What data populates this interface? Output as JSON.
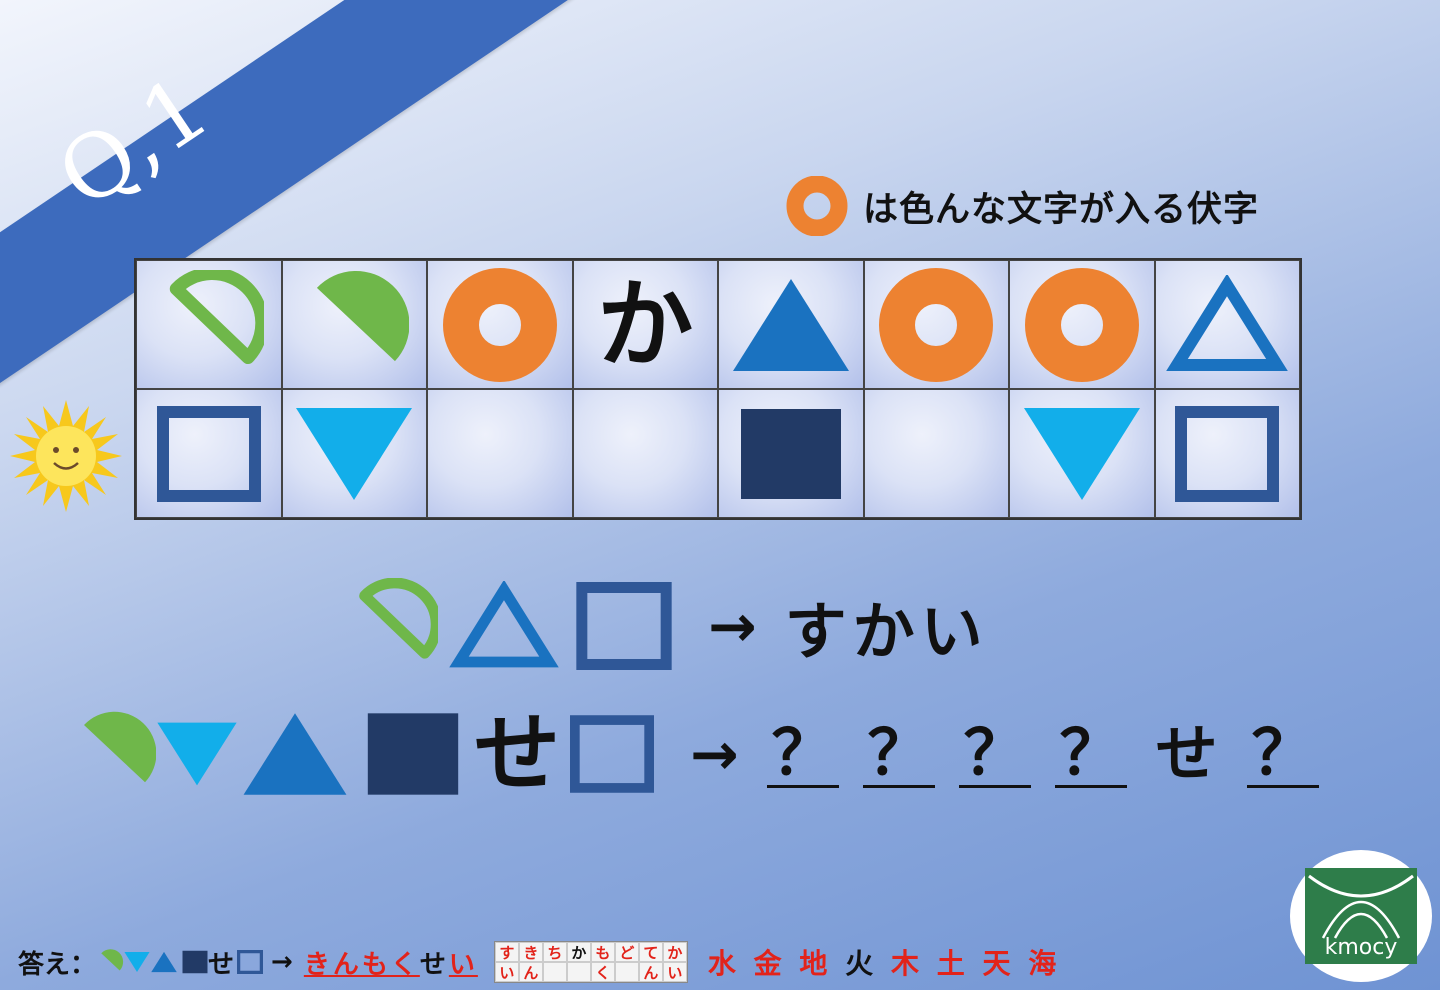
{
  "question_label": "Q,1",
  "legend": {
    "text": "は色んな文字が入る伏字"
  },
  "grid": {
    "top": [
      "hollow-half-circle-icon",
      "filled-half-circle-icon",
      "orange-ring-icon",
      "か",
      "filled-triangle-icon",
      "orange-ring-icon",
      "orange-ring-icon",
      "hollow-triangle-icon"
    ],
    "bottom": [
      "hollow-square-icon",
      "cyan-down-triangle-icon",
      "",
      "",
      "navy-square-icon",
      "",
      "cyan-down-triangle-icon",
      "hollow-square-icon"
    ]
  },
  "example": {
    "answer": "すかい"
  },
  "puzzle": {
    "kana": "せ",
    "blanks": [
      "？",
      "？",
      "？",
      "？",
      "せ",
      "？"
    ]
  },
  "footer": {
    "label": "答え：",
    "kana_se": "せ",
    "arrow": "→",
    "answer_red": "きんもく",
    "answer_dark": "せ",
    "answer_red2": "い",
    "mini_top": [
      "す",
      "き",
      "ち",
      "か",
      "も",
      "ど",
      "て",
      "か"
    ],
    "mini_bottom": [
      "い",
      "ん",
      "",
      "",
      "く",
      "",
      "ん",
      "い"
    ],
    "planets": [
      {
        "t": "水",
        "c": "#e2231a"
      },
      {
        "t": "金",
        "c": "#e2231a"
      },
      {
        "t": "地",
        "c": "#e2231a"
      },
      {
        "t": "火",
        "c": "#111111"
      },
      {
        "t": "木",
        "c": "#e2231a"
      },
      {
        "t": "土",
        "c": "#e2231a"
      },
      {
        "t": "天",
        "c": "#e2231a"
      },
      {
        "t": "海",
        "c": "#e2231a"
      }
    ]
  },
  "logo": {
    "text": "kmocy"
  },
  "colors": {
    "banner": "#3d6bbd",
    "green": "#6fb74a",
    "orange": "#ed8231",
    "blue": "#1a72c0",
    "cyan": "#12aeea",
    "navy": "#223a66",
    "square_outline": "#2f5797",
    "answer_red": "#e2231a"
  }
}
